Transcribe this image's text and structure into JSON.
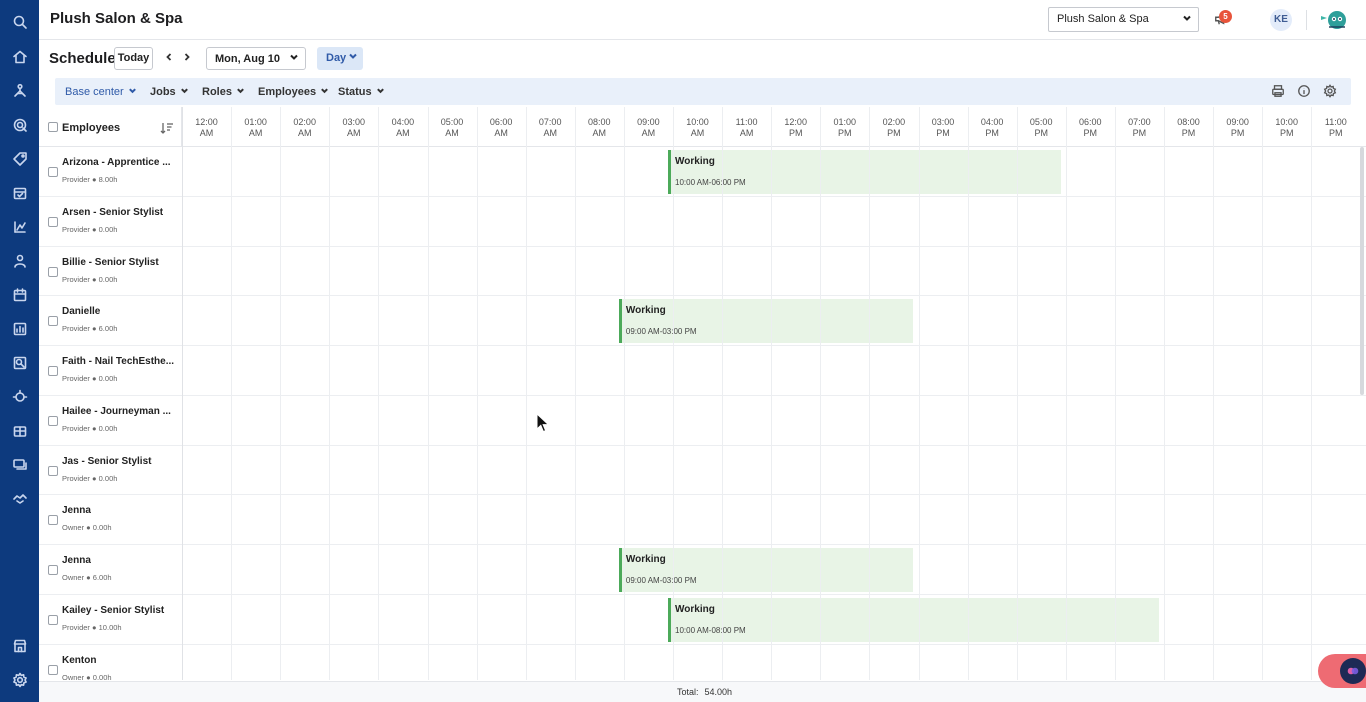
{
  "app": {
    "title": "Plush Salon & Spa",
    "location_selected": "Plush Salon & Spa",
    "notifications_count": "5",
    "user_initials": "KE"
  },
  "rail_icons": [
    "search-icon",
    "home-icon",
    "org-chart-icon",
    "marketing-icon",
    "tag-icon",
    "calendar-check-icon",
    "reports-icon",
    "clients-icon",
    "calendar-icon",
    "dashboard-icon",
    "analytics-icon",
    "integrations-icon",
    "rewards-icon",
    "messages-icon",
    "handshake-icon",
    "store-icon",
    "settings-icon"
  ],
  "schedule": {
    "title": "Schedule",
    "today_label": "Today",
    "date_label": "Mon, Aug 10",
    "view_label": "Day"
  },
  "filters": [
    {
      "label": "Base center",
      "active": true
    },
    {
      "label": "Jobs",
      "active": false
    },
    {
      "label": "Roles",
      "active": false
    },
    {
      "label": "Employees",
      "active": false
    },
    {
      "label": "Status",
      "active": false
    }
  ],
  "grid": {
    "employees_header": "Employees",
    "hours": [
      [
        "12:00",
        "AM"
      ],
      [
        "01:00",
        "AM"
      ],
      [
        "02:00",
        "AM"
      ],
      [
        "03:00",
        "AM"
      ],
      [
        "04:00",
        "AM"
      ],
      [
        "05:00",
        "AM"
      ],
      [
        "06:00",
        "AM"
      ],
      [
        "07:00",
        "AM"
      ],
      [
        "08:00",
        "AM"
      ],
      [
        "09:00",
        "AM"
      ],
      [
        "10:00",
        "AM"
      ],
      [
        "11:00",
        "AM"
      ],
      [
        "12:00",
        "PM"
      ],
      [
        "01:00",
        "PM"
      ],
      [
        "02:00",
        "PM"
      ],
      [
        "03:00",
        "PM"
      ],
      [
        "04:00",
        "PM"
      ],
      [
        "05:00",
        "PM"
      ],
      [
        "06:00",
        "PM"
      ],
      [
        "07:00",
        "PM"
      ],
      [
        "08:00",
        "PM"
      ],
      [
        "09:00",
        "PM"
      ],
      [
        "10:00",
        "PM"
      ],
      [
        "11:00",
        "PM"
      ]
    ]
  },
  "employees": [
    {
      "name": "Arizona - Apprentice ...",
      "role": "Provider",
      "hours": "8.00h",
      "shift": {
        "label": "Working",
        "time": "10:00 AM-06:00 PM",
        "start": 10,
        "end": 18
      }
    },
    {
      "name": "Arsen - Senior Stylist",
      "role": "Provider",
      "hours": "0.00h",
      "shift": null
    },
    {
      "name": "Billie - Senior Stylist",
      "role": "Provider",
      "hours": "0.00h",
      "shift": null
    },
    {
      "name": "Danielle",
      "role": "Provider",
      "hours": "6.00h",
      "shift": {
        "label": "Working",
        "time": "09:00 AM-03:00 PM",
        "start": 9,
        "end": 15
      }
    },
    {
      "name": "Faith - Nail TechEsthe...",
      "role": "Provider",
      "hours": "0.00h",
      "shift": null
    },
    {
      "name": "Hailee - Journeyman ...",
      "role": "Provider",
      "hours": "0.00h",
      "shift": null
    },
    {
      "name": "Jas - Senior Stylist",
      "role": "Provider",
      "hours": "0.00h",
      "shift": null
    },
    {
      "name": "Jenna",
      "role": "Owner",
      "hours": "0.00h",
      "shift": null
    },
    {
      "name": "Jenna",
      "role": "Owner",
      "hours": "6.00h",
      "shift": {
        "label": "Working",
        "time": "09:00 AM-03:00 PM",
        "start": 9,
        "end": 15
      }
    },
    {
      "name": "Kailey - Senior Stylist",
      "role": "Provider",
      "hours": "10.00h",
      "shift": {
        "label": "Working",
        "time": "10:00 AM-08:00 PM",
        "start": 10,
        "end": 20
      }
    },
    {
      "name": "Kenton",
      "role": "Owner",
      "hours": "0.00h",
      "shift": null
    }
  ],
  "footer": {
    "total_label": "Total:",
    "total_value": "54.00h"
  },
  "colors": {
    "rail": "#0d3a7e",
    "shift_bg": "#e8f4e6",
    "shift_border": "#4caa5a",
    "filter_bar": "#e9f0fa",
    "accent": "#2f5aa8"
  }
}
